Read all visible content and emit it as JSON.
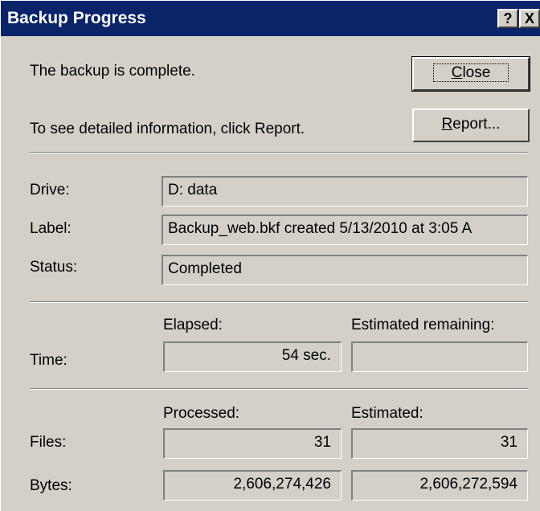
{
  "window": {
    "title": "Backup Progress",
    "help_button": "?",
    "close_button": "X"
  },
  "message": "The backup is complete.",
  "info": "To see detailed information, click Report.",
  "buttons": {
    "close": {
      "mnemonic": "C",
      "rest": "lose"
    },
    "report": {
      "mnemonic": "R",
      "rest": "eport..."
    }
  },
  "details": {
    "drive_label": "Drive:",
    "drive_value": "D: data",
    "label_label": "Label:",
    "label_value": "Backup_web.bkf created 5/13/2010 at 3:05 A",
    "status_label": "Status:",
    "status_value": "Completed"
  },
  "time": {
    "row_label": "Time:",
    "elapsed_header": "Elapsed:",
    "elapsed_value": "54 sec.",
    "remaining_header": "Estimated remaining:",
    "remaining_value": ""
  },
  "counts": {
    "processed_header": "Processed:",
    "estimated_header": "Estimated:",
    "files_label": "Files:",
    "files_processed": "31",
    "files_estimated": "31",
    "bytes_label": "Bytes:",
    "bytes_processed": "2,606,274,426",
    "bytes_estimated": "2,606,272,594"
  }
}
